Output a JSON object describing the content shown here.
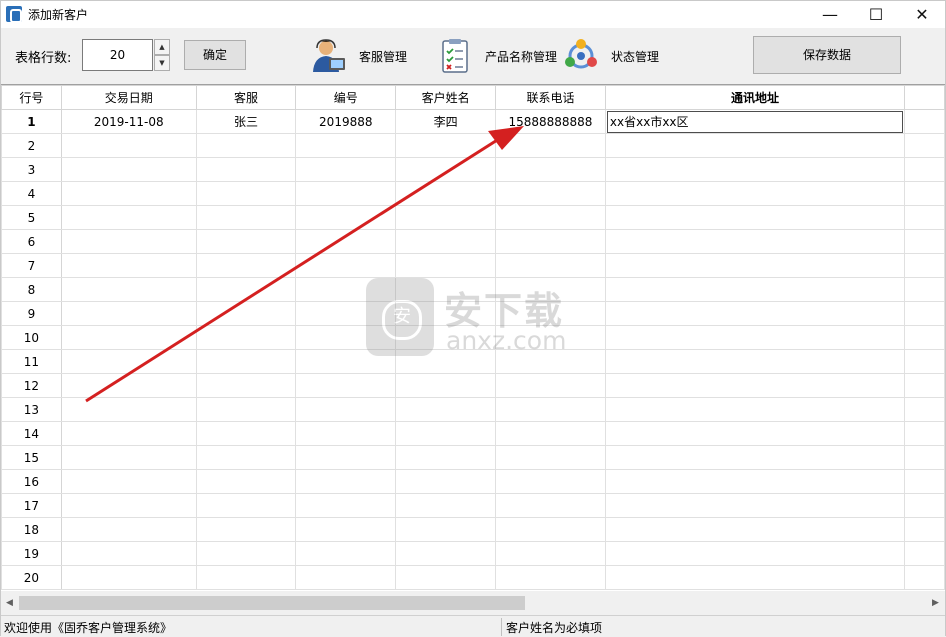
{
  "window": {
    "title": "添加新客户",
    "minimize_glyph": "—",
    "maximize_glyph": "☐",
    "close_glyph": "✕"
  },
  "toolbar": {
    "rows_label": "表格行数:",
    "rows_value": "20",
    "spin_up": "▲",
    "spin_down": "▼",
    "ok_label": "确定",
    "tools": [
      {
        "label": "客服管理",
        "icon": "customer-service-person-icon"
      },
      {
        "label": "产品名称管理",
        "icon": "checklist-document-icon"
      },
      {
        "label": "状态管理",
        "icon": "status-cycle-icon"
      }
    ],
    "save_label": "保存数据"
  },
  "grid": {
    "columns": [
      "行号",
      "交易日期",
      "客服",
      "编号",
      "客户姓名",
      "联系电话",
      "通讯地址"
    ],
    "bold_column": "通讯地址",
    "rows": [
      {
        "num": "1",
        "date": "2019-11-08",
        "service": "张三",
        "code": "2019888",
        "name": "李四",
        "phone": "15888888888",
        "address": "xx省xx市xx区"
      },
      {
        "num": "2"
      },
      {
        "num": "3"
      },
      {
        "num": "4"
      },
      {
        "num": "5"
      },
      {
        "num": "6"
      },
      {
        "num": "7"
      },
      {
        "num": "8"
      },
      {
        "num": "9"
      },
      {
        "num": "10"
      },
      {
        "num": "11"
      },
      {
        "num": "12"
      },
      {
        "num": "13"
      },
      {
        "num": "14"
      },
      {
        "num": "15"
      },
      {
        "num": "16"
      },
      {
        "num": "17"
      },
      {
        "num": "18"
      },
      {
        "num": "19"
      },
      {
        "num": "20"
      }
    ]
  },
  "scrollbar": {
    "left_glyph": "◀",
    "right_glyph": "▶"
  },
  "status": {
    "left": "欢迎使用《固乔客户管理系统》",
    "right": "客户姓名为必填项"
  },
  "watermark": {
    "cn": "安下载",
    "en": "anxz.com"
  },
  "colors": {
    "arrow": "#d42020",
    "app_icon": "#2a6fb8"
  }
}
